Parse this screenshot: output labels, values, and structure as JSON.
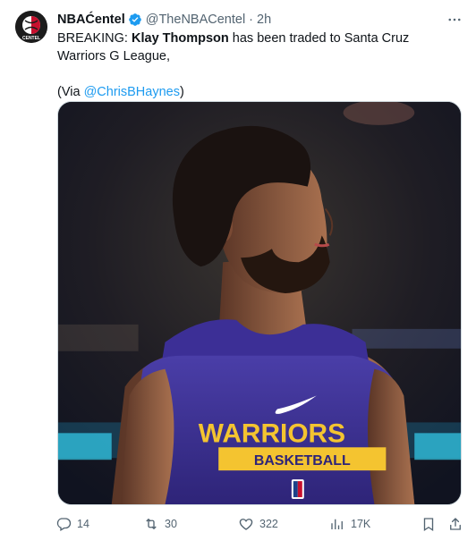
{
  "account": {
    "name": "NBAĆentel",
    "handle": "@TheNBACentel",
    "separator": "·",
    "time": "2h",
    "avatar_icon": "nba-centel-logo-icon",
    "avatar_text": "CENTEL",
    "verified_color": "#1d9bf0"
  },
  "tweet": {
    "prefix": "BREAKING: ",
    "bold_name": "Klay Thompson",
    "suffix": " has been traded to Santa Cruz Warriors G League,",
    "via_open": "(Via ",
    "via_link": "@ChrisBHaynes",
    "via_close": ")"
  },
  "media": {
    "jersey_line1": "WARRIORS",
    "jersey_line2": "BASKETBALL"
  },
  "actions": {
    "replies": "14",
    "retweets": "30",
    "likes": "322",
    "views": "17K"
  },
  "colors": {
    "link": "#1d9bf0",
    "secondary": "#536471",
    "jersey": "#3a2f8f",
    "jersey_gold": "#f4c430"
  }
}
